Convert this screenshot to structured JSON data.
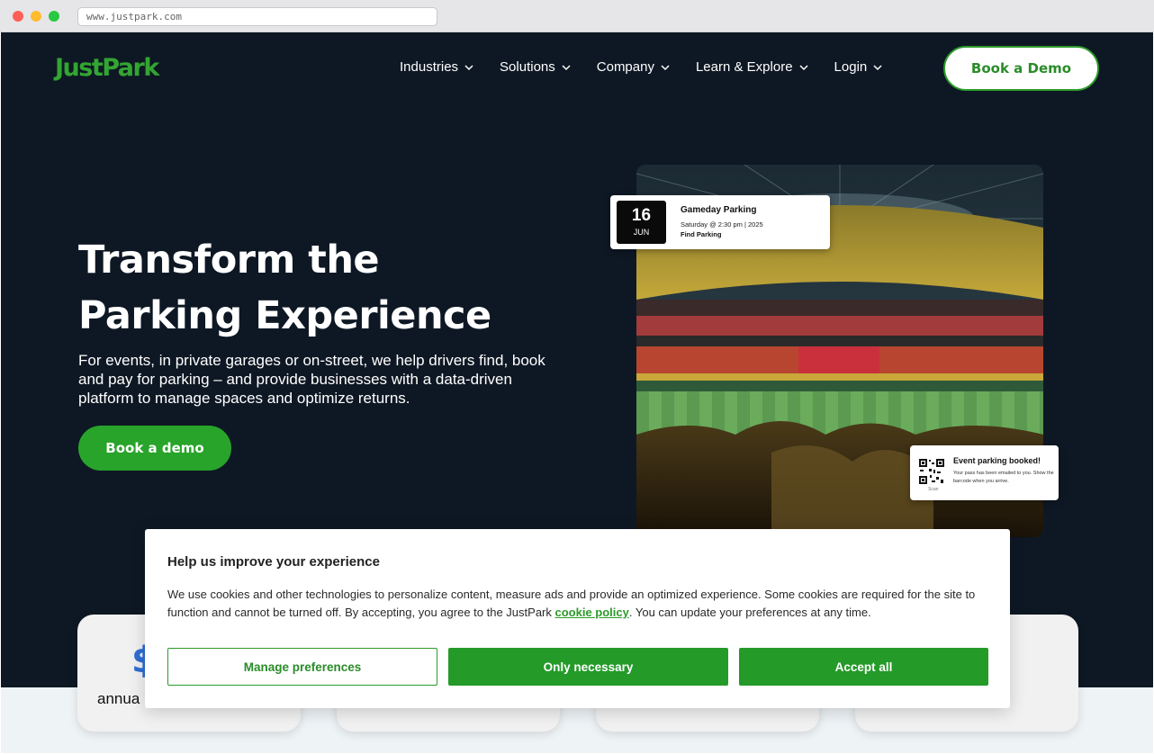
{
  "browser": {
    "url": "www.justpark.com"
  },
  "header": {
    "logo": "JustPark",
    "nav": [
      {
        "label": "Industries"
      },
      {
        "label": "Solutions"
      },
      {
        "label": "Company"
      },
      {
        "label": "Learn & Explore"
      },
      {
        "label": "Login"
      }
    ],
    "cta_label": "Book a Demo"
  },
  "hero": {
    "title_line1": "Transform the",
    "title_line2": "Parking Experience",
    "subtitle": "For events, in private garages or on-street, we help drivers find, book and pay for parking – and provide businesses with a data-driven platform to manage spaces and optimize returns.",
    "cta_label": "Book a demo"
  },
  "gameday_card": {
    "day": "16",
    "month": "JUN",
    "title": "Gameday Parking",
    "when": "Saturday @ 2:30 pm | 2025",
    "link": "Find Parking"
  },
  "booked_card": {
    "title": "Event parking booked!",
    "text": "Your pass has been emailed to you. Show the barcode when you arrive.",
    "qr_label": "Scan"
  },
  "stats": {
    "first_number_partial": "$",
    "first_label_partial": "annua"
  },
  "cookie_dialog": {
    "title": "Help us improve your experience",
    "body_before_link": "We use cookies and other technologies to personalize content, measure ads and provide an optimized experience. Some cookies are required for the site to function and cannot be turned off. By accepting, you agree to the JustPark ",
    "link_text": "cookie policy",
    "body_after_link": ". You can update your preferences at any time.",
    "manage_label": "Manage preferences",
    "necessary_label": "Only necessary",
    "accept_label": "Accept all"
  },
  "colors": {
    "brand_green": "#28a42a",
    "page_dark": "#0e1824",
    "stat_blue": "#2f6dd4"
  }
}
